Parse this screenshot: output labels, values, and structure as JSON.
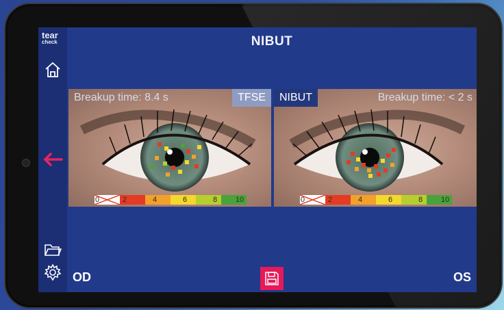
{
  "app": {
    "logo_line1": "tear",
    "logo_line2": "check",
    "title": "NIBUT"
  },
  "sidebar": {
    "icons": [
      "home-icon",
      "back-arrow-icon",
      "folder-icon",
      "gear-icon"
    ],
    "back_arrow_color": "#e8245f"
  },
  "eyes": {
    "left": {
      "breakup_label": "Breakup time: 8.4 s",
      "mode_tag": "TFSE"
    },
    "right": {
      "breakup_label": "Breakup time: < 2 s",
      "mode_tag": "NIBUT"
    },
    "scale": {
      "ticks": [
        "0",
        "2",
        "4",
        "6",
        "8",
        "10"
      ],
      "colors": [
        "#ffffff",
        "#e53a24",
        "#f2a12a",
        "#f4d82c",
        "#b7cf2e",
        "#4aa33a"
      ]
    }
  },
  "footer": {
    "left_label": "OD",
    "right_label": "OS",
    "save_icon": "save-icon",
    "save_color": "#e6195a"
  }
}
